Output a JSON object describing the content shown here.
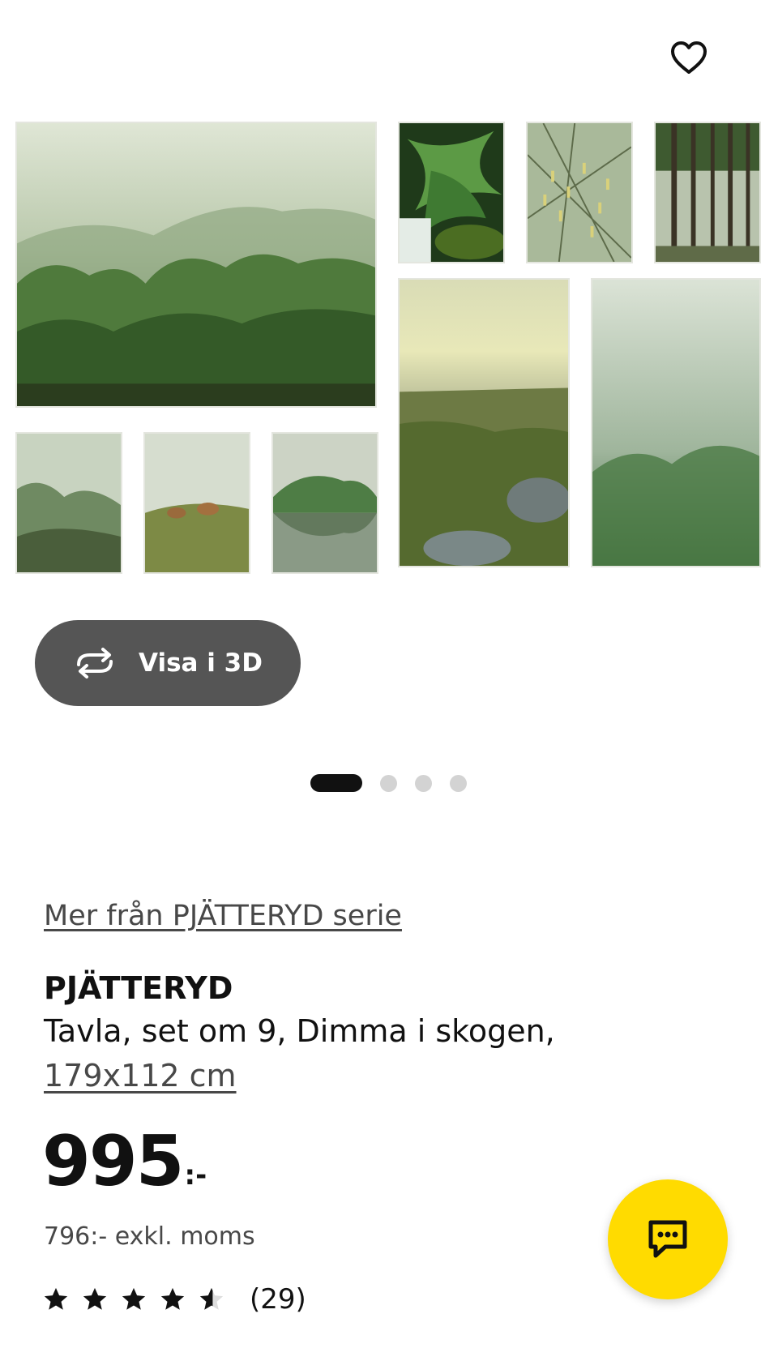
{
  "favorite": {
    "icon": "heart-outline-icon"
  },
  "gallery": {
    "images": [
      "misty-forest-hillside",
      "fern-waterfall",
      "catkins-branches-mist",
      "pine-forest",
      "meadow-with-rocks-dawn",
      "foggy-spruce-forest",
      "bare-trees-fog",
      "deer-in-mist",
      "lake-reflection-mist"
    ]
  },
  "view3d": {
    "label": "Visa i 3D",
    "icon": "rotate-arrows-icon"
  },
  "carousel": {
    "total": 4,
    "active": 1
  },
  "series_link": "Mer från PJÄTTERYD serie",
  "product": {
    "name": "PJÄTTERYD",
    "description": "Tavla, set om 9, Dimma i skogen,",
    "size": "179x112 cm"
  },
  "price": {
    "amount": "995",
    "suffix": ":-",
    "excl_vat": "796:- exkl. moms"
  },
  "rating": {
    "stars": 4.5,
    "count": "(29)"
  },
  "chat": {
    "icon": "chat-bubble-icon",
    "color": "#FFDB00"
  }
}
